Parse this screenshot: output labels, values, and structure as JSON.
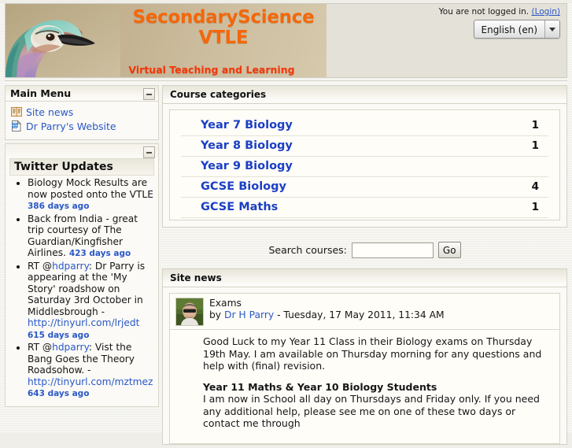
{
  "header": {
    "banner_title_line1": "SecondaryScience",
    "banner_title_line2": "VTLE",
    "banner_subtitle": "Virtual Teaching and Learning Environment",
    "login_text": "You are not logged in.",
    "login_link": "(Login)",
    "language": "English (en)"
  },
  "sidebar": {
    "main_menu": {
      "title": "Main Menu",
      "items": [
        {
          "label": "Site news",
          "icon": "forum-icon"
        },
        {
          "label": "Dr Parry's Website",
          "icon": "link-page-icon"
        }
      ]
    },
    "twitter": {
      "title": "Twitter Updates",
      "tweets": [
        {
          "text": "Biology Mock Results are now posted onto the VTLE",
          "age": "386 days ago"
        },
        {
          "text": "Back from India - great trip courtesy of The Guardian/Kingfisher Airlines.",
          "age": "423 days ago"
        },
        {
          "prefix": "RT @",
          "user": "hdparry",
          "text": ": Dr Parry is appearing at the 'My Story' roadshow on Saturday 3rd October in Middlesbrough - ",
          "url": "http://tinyurl.com/lrjedt",
          "age": "615 days ago"
        },
        {
          "prefix": "RT @",
          "user": "hdparry",
          "text": ": Vist the Bang Goes the Theory Roadsohow. - ",
          "url": "http://tinyurl.com/mztmez",
          "age": "643 days ago"
        }
      ]
    }
  },
  "main": {
    "categories_panel_title": "Course categories",
    "categories": [
      {
        "name": "Year 7 Biology",
        "count": "1"
      },
      {
        "name": "Year 8 Biology",
        "count": "1"
      },
      {
        "name": "Year 9 Biology",
        "count": ""
      },
      {
        "name": "GCSE Biology",
        "count": "4"
      },
      {
        "name": "GCSE Maths",
        "count": "1"
      }
    ],
    "search": {
      "label": "Search courses:",
      "value": "",
      "placeholder": "",
      "button": "Go"
    },
    "news_panel_title": "Site news",
    "post": {
      "subject": "Exams",
      "by_prefix": "by ",
      "author": "Dr H Parry",
      "date": " - Tuesday, 17 May 2011, 11:34 AM",
      "paragraph1": "Good Luck to my Year 11 Class in their Biology exams on Thursday 19th May. I am available on Thursday morning for any questions and help with (final) revision.",
      "heading2": "Year 11 Maths & Year 10 Biology Students",
      "paragraph2": "I am now in School all day on Thursdays and Friday only. If you need any additional help, please see me on one of these two days or contact me through"
    }
  },
  "colors": {
    "brand_orange": "#f4670a",
    "brand_red": "#f4380a",
    "link_blue": "#2a58c8",
    "category_blue": "#1b3fc4",
    "page_bg": "#f2f1ec",
    "header_bg": "#e4e1d8"
  }
}
